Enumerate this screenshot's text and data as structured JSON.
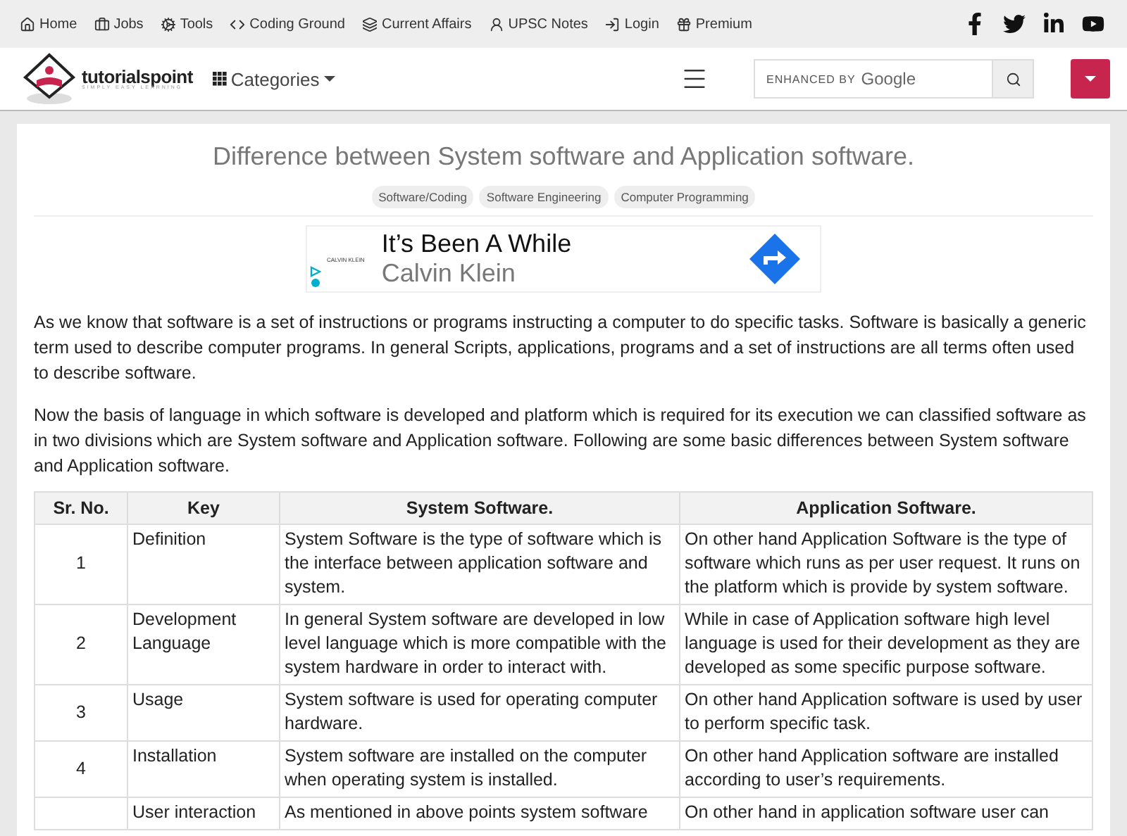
{
  "top_nav": [
    "Home",
    "Jobs",
    "Tools",
    "Coding Ground",
    "Current Affairs",
    "UPSC Notes",
    "Login",
    "Premium"
  ],
  "logo": {
    "name": "tutorialspoint",
    "tagline": "SIMPLY EASY LEARNING"
  },
  "categories": "Categories",
  "search": {
    "placeholder_prefix": "ENHANCED BY",
    "placeholder_brand": "Google"
  },
  "title": "Difference between System software and Application software.",
  "tags": [
    "Software/Coding",
    "Software Engineering",
    "Computer Programming"
  ],
  "ad": {
    "brand": "CALVIN KLEIN",
    "headline": "It’s Been A While",
    "advertiser": "Calvin Klein"
  },
  "paragraphs": [
    "As we know that software is a set of instructions or programs instructing a computer to do specific tasks. Software is basically a generic term used to describe computer programs. In general Scripts, applications, programs and a set of instructions are all terms often used to describe software.",
    "Now the basis of language in which software is developed and platform which is required for its execution we can classified software as in two divisions which are System software and Application software. Following are some basic differences between System software and Application software."
  ],
  "table": {
    "columns": [
      "Sr. No.",
      "Key",
      "System Software.",
      "Application Software."
    ],
    "rows": [
      [
        "1",
        "Definition",
        "System Software is the type of software which is the interface between application software and system.",
        "On other hand Application Software is the type of software which runs as per user request. It runs on the platform which is provide by system software."
      ],
      [
        "2",
        "Development Language",
        "In general System software are developed in low level language which is more compatible with the system hardware in order to interact with.",
        "While in case of Application software high level language is used for their development as they are developed as some specific purpose software."
      ],
      [
        "3",
        "Usage",
        "System software is used for operating computer hardware.",
        "On other hand Application software is used by user to perform specific task."
      ],
      [
        "4",
        "Installation",
        "System software are installed on the computer when operating system is installed.",
        "On other hand Application software are installed according to user’s requirements."
      ],
      [
        null,
        "User interaction",
        "As mentioned in above points system software",
        "On other hand in application software user can"
      ]
    ]
  }
}
